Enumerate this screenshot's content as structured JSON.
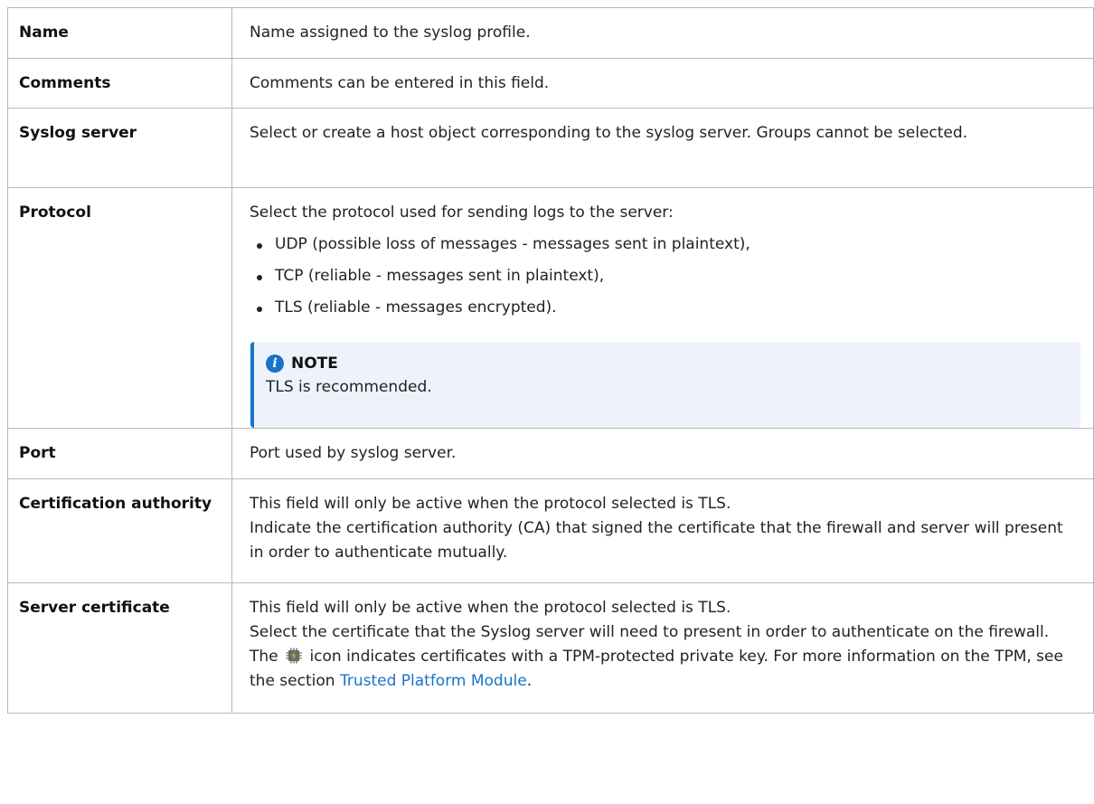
{
  "rows": {
    "name": {
      "label": "Name",
      "desc": "Name assigned to the syslog profile."
    },
    "comments": {
      "label": "Comments",
      "desc": "Comments can be entered in this field."
    },
    "syslog_server": {
      "label": "Syslog server",
      "desc": "Select or create a host object corresponding to the syslog server. Groups cannot be selected."
    },
    "protocol": {
      "label": "Protocol",
      "intro": "Select the protocol used for sending logs to the server:",
      "options": [
        "UDP (possible loss of messages - messages sent in plaintext),",
        "TCP (reliable - messages sent in plaintext),",
        "TLS (reliable - messages encrypted)."
      ],
      "note": {
        "icon": "info-icon",
        "title": "NOTE",
        "text": "TLS is recommended."
      }
    },
    "port": {
      "label": "Port",
      "desc": "Port used by syslog server."
    },
    "certification_authority": {
      "label": "Certification authority",
      "line1": "This field will only be active when the protocol selected is TLS.",
      "line2": "Indicate the certification authority (CA) that signed the certificate that the firewall and server will present in order to authenticate mutually."
    },
    "server_certificate": {
      "label": "Server certificate",
      "line1": "This field will only be active when the protocol selected is TLS.",
      "line2": "Select the certificate that the Syslog server will need to present in order to authenticate on the firewall.",
      "line3_before": "The",
      "tpm_icon": "tpm-chip-icon",
      "line3_after": "icon indicates certificates with a TPM-protected private key. For more information on the TPM, see the section",
      "link_text": "Trusted Platform Module",
      "line3_end": "."
    }
  },
  "colors": {
    "border": "#b8b8b8",
    "note_background": "#eef3fb",
    "accent": "#1a73c8"
  }
}
